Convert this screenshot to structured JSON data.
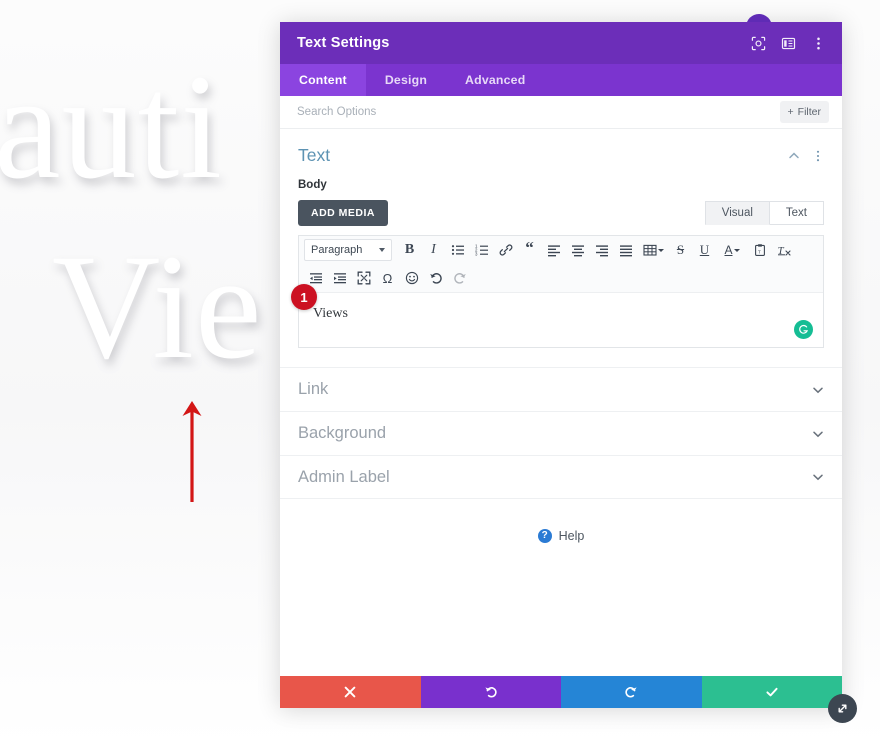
{
  "background_page": {
    "word_1": "auti",
    "word_2": "Vie",
    "annotation_arrow": "red-up-arrow"
  },
  "modal": {
    "title": "Text Settings",
    "header_icons": [
      {
        "name": "focus-target-icon",
        "label": "Focus"
      },
      {
        "name": "layout-panel-icon",
        "label": "Layout"
      },
      {
        "name": "more-options-icon",
        "label": "More"
      }
    ],
    "tabs": [
      {
        "label": "Content",
        "active": true
      },
      {
        "label": "Design",
        "active": false
      },
      {
        "label": "Advanced",
        "active": false
      }
    ],
    "search": {
      "placeholder": "Search Options",
      "value": "",
      "filter_label": "Filter",
      "filter_plus": "+"
    },
    "text_section": {
      "title": "Text",
      "body_label": "Body",
      "add_media_label": "ADD MEDIA",
      "editor_mode_tabs": [
        {
          "label": "Visual",
          "active": true
        },
        {
          "label": "Text",
          "active": false
        }
      ],
      "toolbar_row1": [
        {
          "name": "paragraph-format-select",
          "label": "Paragraph"
        },
        {
          "name": "bold-icon",
          "glyph": "B"
        },
        {
          "name": "italic-icon",
          "glyph": "I"
        },
        {
          "name": "bulleted-list-icon"
        },
        {
          "name": "numbered-list-icon"
        },
        {
          "name": "link-icon"
        },
        {
          "name": "blockquote-icon",
          "glyph": "“"
        },
        {
          "name": "align-left-icon"
        },
        {
          "name": "align-center-icon"
        },
        {
          "name": "align-right-icon"
        },
        {
          "name": "align-justify-icon"
        },
        {
          "name": "table-icon"
        },
        {
          "name": "strikethrough-icon",
          "glyph": "S"
        },
        {
          "name": "underline-icon",
          "glyph": "U"
        },
        {
          "name": "text-color-icon",
          "glyph": "A"
        },
        {
          "name": "paste-as-text-icon"
        },
        {
          "name": "clear-formatting-icon"
        }
      ],
      "toolbar_row2": [
        {
          "name": "outdent-icon"
        },
        {
          "name": "indent-icon"
        },
        {
          "name": "fullscreen-icon"
        },
        {
          "name": "special-character-icon",
          "glyph": "Ω"
        },
        {
          "name": "emoji-icon"
        },
        {
          "name": "undo-icon"
        },
        {
          "name": "redo-icon"
        }
      ],
      "content_value": "Views",
      "grammar_badge": "grammarly-icon",
      "step_badge": "1"
    },
    "accordion": [
      {
        "label": "Link",
        "expanded": false
      },
      {
        "label": "Background",
        "expanded": false
      },
      {
        "label": "Admin Label",
        "expanded": false
      }
    ],
    "help": {
      "label": "Help",
      "icon_glyph": "?"
    },
    "footer": [
      {
        "name": "cancel-button",
        "icon": "close-icon",
        "color": "#e8564a"
      },
      {
        "name": "undo-button",
        "icon": "undo-icon",
        "color": "#7930cd"
      },
      {
        "name": "redo-button",
        "icon": "redo-icon",
        "color": "#2585d6"
      },
      {
        "name": "save-button",
        "icon": "check-icon",
        "color": "#2cbf91"
      }
    ],
    "resize_handle": "resize-diagonal-icon"
  },
  "colors": {
    "header_purple": "#6c2eb9",
    "tabs_purple": "#7b34cf",
    "active_tab_purple": "#8b44e0",
    "section_title_blue": "#5d93b3",
    "badge_red": "#cc1122",
    "grammar_teal": "#15bd94"
  }
}
